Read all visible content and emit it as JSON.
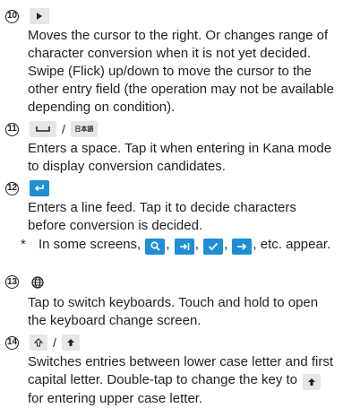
{
  "items": [
    {
      "number": "10",
      "keys": [
        "right-arrow-key"
      ],
      "description": "Moves the cursor to the right. Or changes range of character conversion when it is not yet decided. Swipe (Flick) up/down to move the cursor to the other entry field (the operation may not be available depending on condition)."
    },
    {
      "number": "11",
      "keys": [
        "space-key",
        "conversion-key"
      ],
      "separator": "/",
      "conversion_key_label": "日本語",
      "description": "Enters a space. Tap it when entering in Kana mode to display conversion candidates."
    },
    {
      "number": "12",
      "keys": [
        "enter-key"
      ],
      "description": "Enters a line feed. Tap it to decide characters before conversion is decided.",
      "note": {
        "marker": "*",
        "text_before": "In some screens,",
        "text_after": ", etc. appear."
      }
    },
    {
      "number": "13",
      "keys": [
        "globe-key"
      ],
      "description": "Tap to switch keyboards. Touch and hold to open the keyboard change screen."
    },
    {
      "number": "14",
      "keys": [
        "shift-outline-key",
        "shift-filled-key"
      ],
      "separator": "/",
      "description": "Switches entries between lower case letter and first capital letter. Double-tap to change the key to",
      "description_end": "for entering upper case letter."
    }
  ],
  "colors": {
    "accent_blue": "#1e8fd6",
    "key_gray": "#e6e6e6",
    "text": "#231f20"
  }
}
